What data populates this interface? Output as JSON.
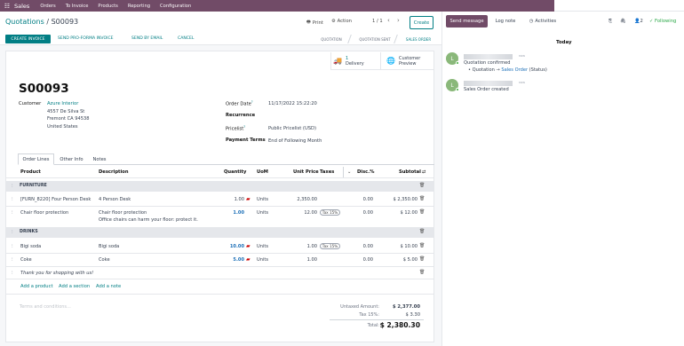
{
  "topnav": {
    "app_name": "Sales",
    "menus": [
      "Orders",
      "To Invoice",
      "Products",
      "Reporting",
      "Configuration"
    ]
  },
  "control": {
    "breadcrumb_parent": "Quotations",
    "breadcrumb_sep": "/",
    "breadcrumb_current": "S00093",
    "print_label": "Print",
    "action_label": "Action",
    "pager": "1 / 1",
    "create_label": "Create"
  },
  "actions": {
    "create_invoice": "CREATE INVOICE",
    "send_proforma": "SEND PRO-FORMA INVOICE",
    "send_email": "SEND BY EMAIL",
    "cancel": "CANCEL"
  },
  "statusbar": {
    "stages": [
      "QUOTATION",
      "QUOTATION SENT",
      "SALES ORDER"
    ],
    "active_stage": "SALES ORDER"
  },
  "smart_buttons": {
    "delivery_count": "1",
    "delivery_label": "Delivery",
    "preview_top": "Customer",
    "preview_bottom": "Preview"
  },
  "form": {
    "name": "S00093",
    "customer_label": "Customer",
    "customer_name": "Azure Interior",
    "address_lines": [
      "4557 De Silva St",
      "Fremont CA 94538",
      "United States"
    ],
    "order_date_label": "Order Date",
    "order_date": "11/17/2022 15:22:20",
    "recurrence_label": "Recurrence",
    "pricelist_label": "Pricelist",
    "pricelist": "Public Pricelist (USD)",
    "payment_terms_label": "Payment Terms",
    "payment_terms": "End of Following Month"
  },
  "tabs": [
    "Order Lines",
    "Other Info",
    "Notes"
  ],
  "columns": {
    "product": "Product",
    "description": "Description",
    "quantity": "Quantity",
    "uom": "UoM",
    "unit_price": "Unit Price",
    "taxes": "Taxes",
    "disc": "Disc.%",
    "subtotal": "Subtotal"
  },
  "sections": [
    "FURNITURE",
    "DRINKS"
  ],
  "lines": [
    {
      "product": "[FURN_8220] Four Person Desk",
      "description": "4 Person Desk",
      "quantity": "1.00",
      "uom": "Units",
      "unit_price": "2,350.00",
      "taxes": "",
      "disc": "0.00",
      "subtotal": "$ 2,350.00"
    },
    {
      "product": "Chair floor protection",
      "description": "Chair floor protection",
      "description2": "Office chairs can harm your floor: protect it.",
      "quantity": "1.00",
      "uom": "Units",
      "unit_price": "12.00",
      "taxes": "Tax 15%",
      "disc": "0.00",
      "subtotal": "$ 12.00"
    },
    {
      "product": "Bigi soda",
      "description": "Bigi soda",
      "quantity": "10.00",
      "uom": "Units",
      "unit_price": "1.00",
      "taxes": "Tax 15%",
      "disc": "0.00",
      "subtotal": "$ 10.00"
    },
    {
      "product": "Coke",
      "description": "Coke",
      "quantity": "5.00",
      "uom": "Units",
      "unit_price": "1.00",
      "taxes": "",
      "disc": "0.00",
      "subtotal": "$ 5.00"
    }
  ],
  "note_line": "Thank you for shopping with us!",
  "add_links": [
    "Add a product",
    "Add a section",
    "Add a note"
  ],
  "terms_placeholder": "Terms and conditions...",
  "totals": {
    "untaxed_label": "Untaxed Amount:",
    "untaxed": "$ 2,377.00",
    "tax_label": "Tax 15%:",
    "tax": "$ 3.30",
    "total_label": "Total:",
    "total": "$ 2,380.30"
  },
  "chatter": {
    "send_message": "Send message",
    "log_note": "Log note",
    "activities": "Activities",
    "followers_count": "2",
    "following": "Following",
    "today": "Today",
    "msg1_title": "Quotation confirmed",
    "msg1_bullet_from": "Quotation",
    "msg1_bullet_to": "Sales Order",
    "msg1_bullet_field": "(Status)",
    "msg2_text": "Sales Order created",
    "avatar_initial": "L",
    "time_label": "now"
  }
}
